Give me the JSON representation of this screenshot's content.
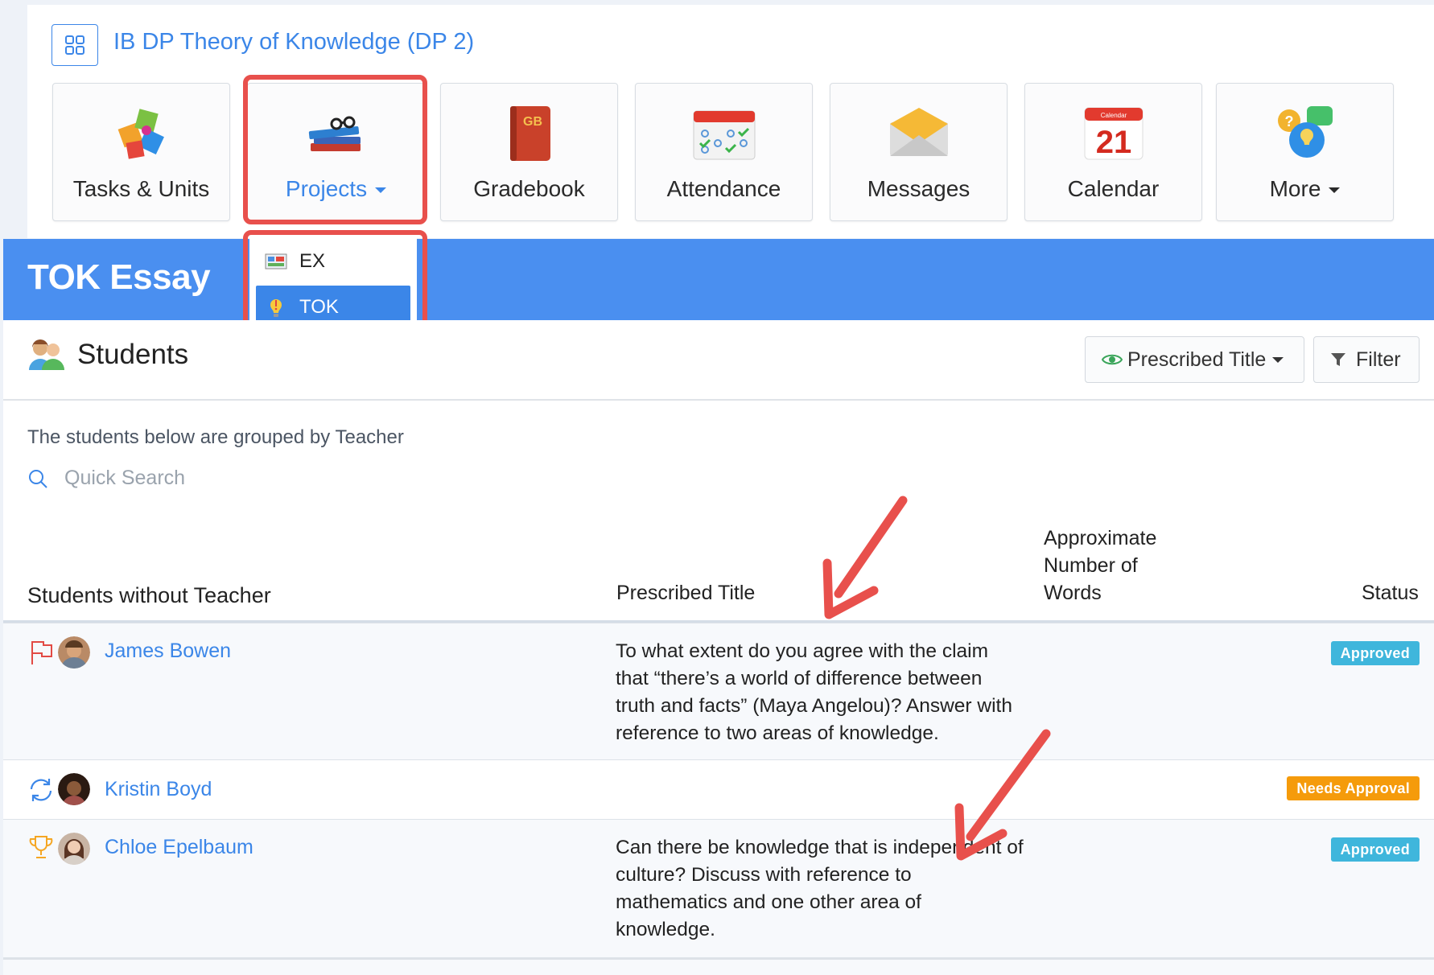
{
  "course": {
    "title": "IB DP Theory of Knowledge (DP 2)",
    "icon": "grid-icon"
  },
  "nav": [
    {
      "label": "Tasks & Units",
      "icon": "puzzle-icon"
    },
    {
      "label": "Projects",
      "icon": "books-icon",
      "active": true,
      "caret": true
    },
    {
      "label": "Gradebook",
      "icon": "gradebook-icon"
    },
    {
      "label": "Attendance",
      "icon": "attendance-calendar-icon"
    },
    {
      "label": "Messages",
      "icon": "envelope-icon"
    },
    {
      "label": "Calendar",
      "icon": "calendar-icon",
      "day": "21",
      "month": "Calendar"
    },
    {
      "label": "More",
      "icon": "help-chat-icon",
      "caret": true
    }
  ],
  "projects_menu": {
    "items": [
      {
        "label": "EX",
        "icon": "ex-project-icon"
      },
      {
        "label": "TOK",
        "icon": "lightbulb-icon",
        "selected": true
      }
    ]
  },
  "page": {
    "title": "TOK Essay"
  },
  "students_section": {
    "title": "Students",
    "icon": "students-icon",
    "prescribed_title_button": "Prescribed Title",
    "filter_button": "Filter",
    "grouped_note": "The students below are grouped by Teacher",
    "search_placeholder": "Quick Search"
  },
  "table": {
    "group_label": "Students without Teacher",
    "headers": {
      "prescribed_title": "Prescribed Title",
      "approx_words_1": "Approximate",
      "approx_words_2": "Number of",
      "approx_words_3": "Words",
      "status": "Status"
    },
    "rows": [
      {
        "name": "James Bowen",
        "status_icon": "flag-icon",
        "prescribed_title": "To what extent do you agree with the claim that “there’s a world of difference between truth and facts” (Maya Angelou)? Answer with reference to two areas of knowledge.",
        "status": "Approved"
      },
      {
        "name": "Kristin Boyd",
        "status_icon": "sync-icon",
        "prescribed_title": "",
        "status": "Needs Approval"
      },
      {
        "name": "Chloe Epelbaum",
        "status_icon": "trophy-icon",
        "prescribed_title": "Can there be knowledge that is independent of culture? Discuss with reference to mathematics and one other area of knowledge.",
        "status": "Approved"
      }
    ]
  },
  "colors": {
    "accent": "#3b86e8",
    "banner": "#4a8ff0",
    "highlight": "#e8504c",
    "approved": "#3fb6dc",
    "needs_approval": "#f59b0b"
  }
}
